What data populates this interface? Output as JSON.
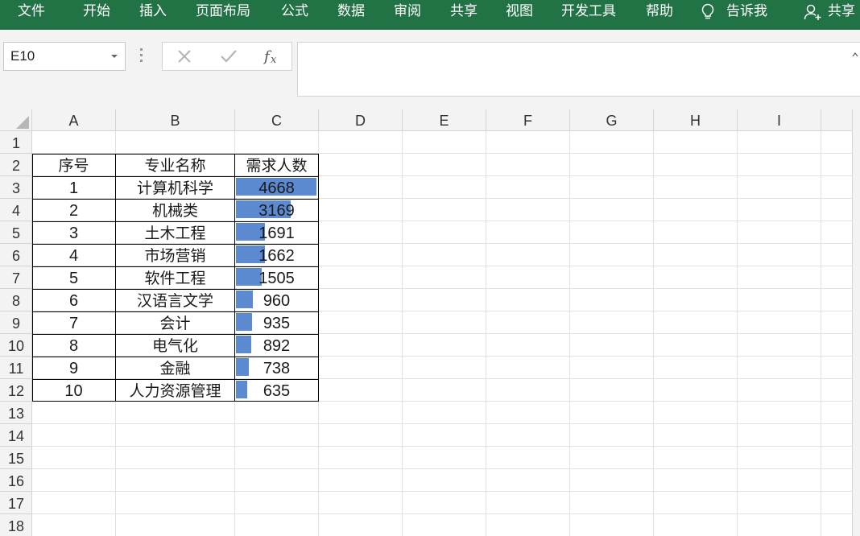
{
  "ribbon": {
    "tabs": [
      "文件",
      "开始",
      "插入",
      "页面布局",
      "公式",
      "数据",
      "审阅",
      "共享",
      "视图",
      "开发工具",
      "帮助"
    ],
    "tell_me": "告诉我",
    "share": "共享",
    "color": "#217346"
  },
  "formula_bar": {
    "name_box": "E10",
    "formula": ""
  },
  "columns": [
    "A",
    "B",
    "C",
    "D",
    "E",
    "F",
    "G",
    "H",
    "I"
  ],
  "rows": [
    "1",
    "2",
    "3",
    "4",
    "5",
    "6",
    "7",
    "8",
    "9",
    "10",
    "11",
    "12",
    "13",
    "14",
    "15",
    "16",
    "17",
    "18"
  ],
  "table": {
    "headers": [
      "序号",
      "专业名称",
      "需求人数"
    ],
    "rows": [
      {
        "no": "1",
        "major": "计算机科学",
        "demand": "4668",
        "value": 4668
      },
      {
        "no": "2",
        "major": "机械类",
        "demand": "3169",
        "value": 3169
      },
      {
        "no": "3",
        "major": "土木工程",
        "demand": "1691",
        "value": 1691
      },
      {
        "no": "4",
        "major": "市场营销",
        "demand": "1662",
        "value": 1662
      },
      {
        "no": "5",
        "major": "软件工程",
        "demand": "1505",
        "value": 1505
      },
      {
        "no": "6",
        "major": "汉语言文学",
        "demand": "960",
        "value": 960
      },
      {
        "no": "7",
        "major": "会计",
        "demand": "935",
        "value": 935
      },
      {
        "no": "8",
        "major": "电气化",
        "demand": "892",
        "value": 892
      },
      {
        "no": "9",
        "major": "金融",
        "demand": "738",
        "value": 738
      },
      {
        "no": "10",
        "major": "人力资源管理",
        "demand": "635",
        "value": 635
      }
    ],
    "databar_color": "#5b8ad1",
    "databar_max": 4668
  }
}
